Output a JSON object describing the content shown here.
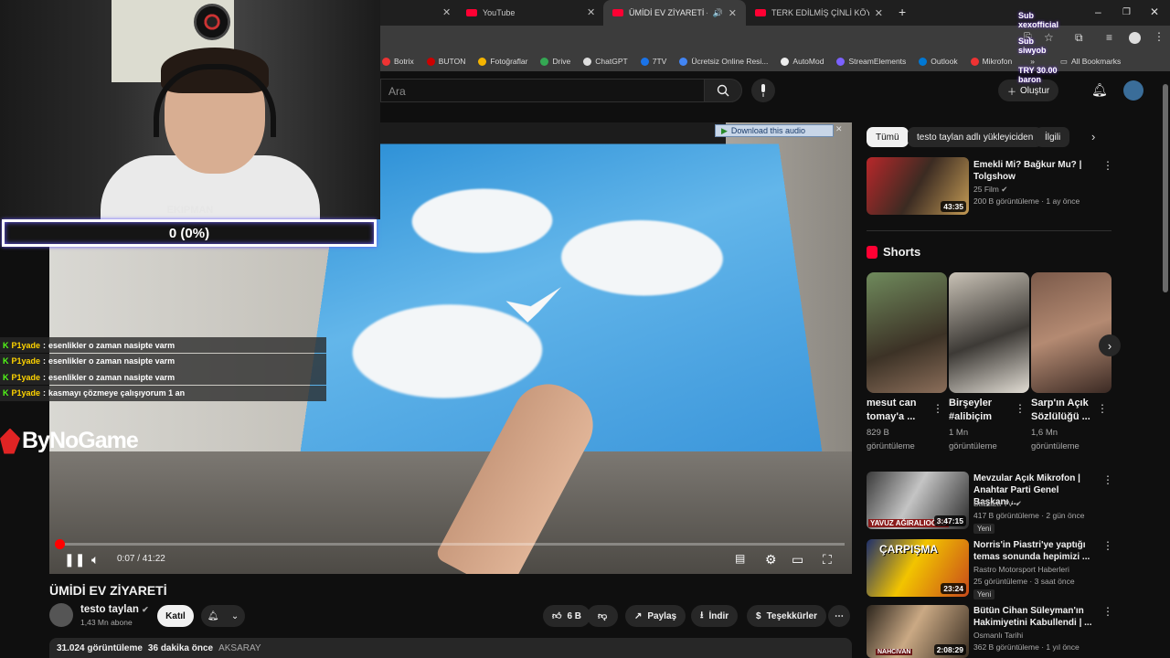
{
  "browser": {
    "tabs": [
      {
        "label": "YouTube",
        "active": false
      },
      {
        "label": "ÜMİDİ EV ZİYARETİ - YouTu",
        "active": true
      },
      {
        "label": "TERK EDİLMİŞ ÇİNLİ KÖYDE BİR",
        "active": false
      }
    ],
    "bookmarks": [
      "Botrix",
      "BUTON",
      "Fotoğraflar",
      "Drive",
      "ChatGPT",
      "7TV",
      "Ücretsiz Online Resi...",
      "AutoMod",
      "StreamElements",
      "Outlook",
      "Mikrofon"
    ],
    "all_bookmarks": "All Bookmarks"
  },
  "stream_overlay": {
    "sub_lines": [
      "Sub",
      "xexofficial",
      "Sub",
      "siwyob",
      "TRY 30.00",
      "baron"
    ],
    "ekipman_label": "EKIPMAN",
    "ekipman_value": "0 (0%)",
    "brand": "ByNoGame",
    "chat": [
      {
        "user": "P1yade",
        "msg": "esenlikler o zaman nasipte varm"
      },
      {
        "user": "P1yade",
        "msg": "esenlikler o zaman nasipte varm"
      },
      {
        "user": "P1yade",
        "msg": "esenlikler o zaman nasipte varm"
      },
      {
        "user": "P1yade",
        "msg": "kasmayı çözmeye çalışıyorum 1 an"
      }
    ]
  },
  "header": {
    "search_placeholder": "Ara",
    "create_label": "Oluştur"
  },
  "player": {
    "download_audio": "Download this audio",
    "time": "0:07 / 41:22",
    "progress": 0.003
  },
  "video": {
    "title": "ÜMİDİ EV ZİYARETİ",
    "channel": "testo taylan",
    "subscribers": "1,43 Mn abone",
    "join_label": "Katıl",
    "likes": "6 B",
    "share_label": "Paylaş",
    "download_label": "İndir",
    "thanks_label": "Teşekkürler",
    "views": "31.024 görüntüleme",
    "ago": "36 dakika önce",
    "location": "AKSARAY"
  },
  "chips": [
    "Tümü",
    "testo taylan adlı yükleyiciden",
    "İlgili"
  ],
  "related_top": {
    "title": "Emekli Mi? Bağkur Mu? | Tolgshow",
    "channel": "25 Film",
    "meta": "200 B görüntüleme · 1 ay önce",
    "duration": "43:35"
  },
  "shorts": {
    "heading": "Shorts",
    "items": [
      {
        "title": "mesut can tomay'a ...",
        "views": "829 B",
        "suffix": "görüntüleme"
      },
      {
        "title": "Birşeyler #alibiçim",
        "views": "1 Mn",
        "suffix": "görüntüleme"
      },
      {
        "title": "Sarp'ın Açık Sözlülüğü ...",
        "views": "1,6 Mn",
        "suffix": "görüntüleme"
      }
    ]
  },
  "related": [
    {
      "title": "Mevzular Açık Mikrofon | Anahtar Parti Genel Başkanı ...",
      "channel": "BaBaLa TV",
      "meta": "417 B görüntüleme · 2 gün önce",
      "badge": "Yeni",
      "duration": "3:47:15",
      "thumb_text": "YAVUZ AĞIRALIOĞLU"
    },
    {
      "title": "Norris'in Piastri'ye yaptığı temas sonunda hepimizi ...",
      "channel": "Rastro Motorsport Haberleri",
      "meta": "25 görüntüleme · 3 saat önce",
      "badge": "Yeni",
      "duration": "23:24",
      "thumb_text": "ÇARPIŞMA"
    },
    {
      "title": "Bütün Cihan Süleyman'ın Hakimiyetini Kabullendi | ...",
      "channel": "Osmanlı Tarihi",
      "meta": "362 B görüntüleme · 1 yıl önce",
      "badge": "",
      "duration": "2:08:29",
      "thumb_text": "NAHCIVAN"
    }
  ]
}
